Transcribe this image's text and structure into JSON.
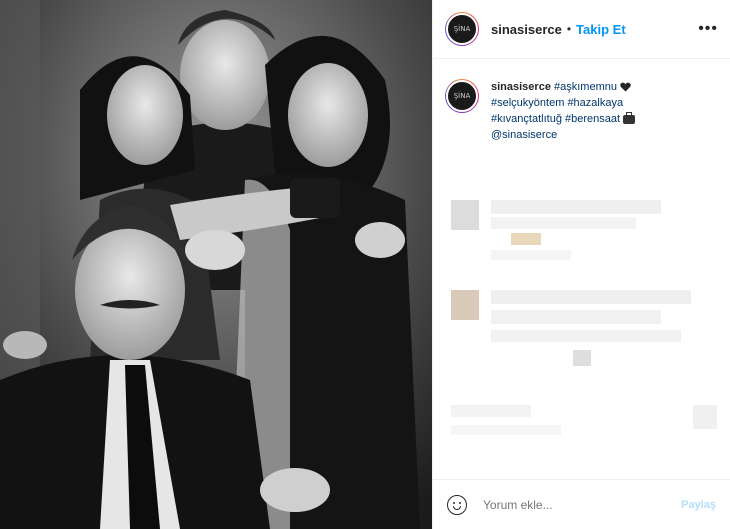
{
  "post": {
    "username": "sinasiserce",
    "separator": "•",
    "follow_label": "Takip Et",
    "more_label": "•••",
    "avatar_text": "ŞİNA"
  },
  "caption": {
    "username": "sinasiserce",
    "tags": [
      "#aşkımemnu",
      "#selçukyöntem",
      "#hazalkaya",
      "#kıvançtatlıtuğ",
      "#berensaat",
      "@sinasiserce"
    ]
  },
  "comment_box": {
    "placeholder": "Yorum ekle...",
    "submit_label": "Paylaş"
  },
  "colors": {
    "accent": "#0095f6",
    "text": "#262626",
    "tag": "#00376b",
    "muted": "#8e8e8e",
    "submit_disabled": "#b2dffc"
  }
}
